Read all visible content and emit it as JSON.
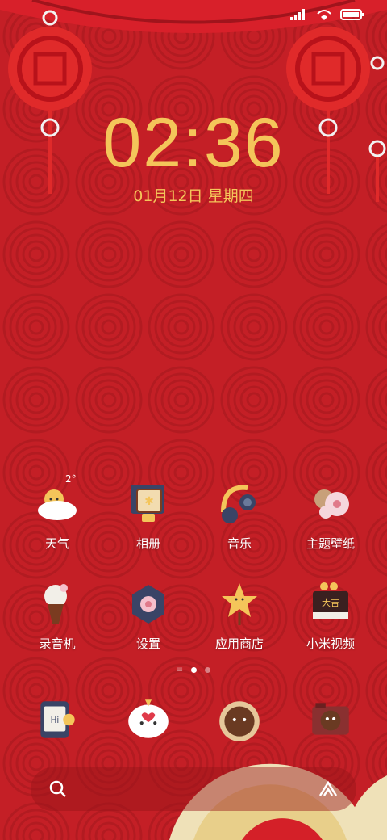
{
  "lock": {
    "time": "02:36",
    "date": "01月12日 星期四"
  },
  "status_bar": {
    "icons": [
      "signal-icon",
      "wifi-icon",
      "battery-icon"
    ]
  },
  "weather": {
    "temperature": "2°"
  },
  "apps_row1": [
    {
      "label": "天气",
      "icon": "weather-icon"
    },
    {
      "label": "相册",
      "icon": "gallery-icon"
    },
    {
      "label": "音乐",
      "icon": "music-icon"
    },
    {
      "label": "主题壁纸",
      "icon": "themes-icon"
    }
  ],
  "apps_row2": [
    {
      "label": "录音机",
      "icon": "recorder-icon"
    },
    {
      "label": "设置",
      "icon": "settings-icon"
    },
    {
      "label": "应用商店",
      "icon": "app-store-icon"
    },
    {
      "label": "小米视频",
      "icon": "video-icon"
    }
  ],
  "dock": [
    {
      "icon": "phone-icon"
    },
    {
      "icon": "messages-icon"
    },
    {
      "icon": "browser-icon"
    },
    {
      "icon": "camera-icon"
    }
  ],
  "pager": {
    "count": 3,
    "active": 1
  },
  "colors": {
    "background": "#c41f26",
    "gold": "#f4c55a",
    "lantern": "#e02a2a"
  }
}
